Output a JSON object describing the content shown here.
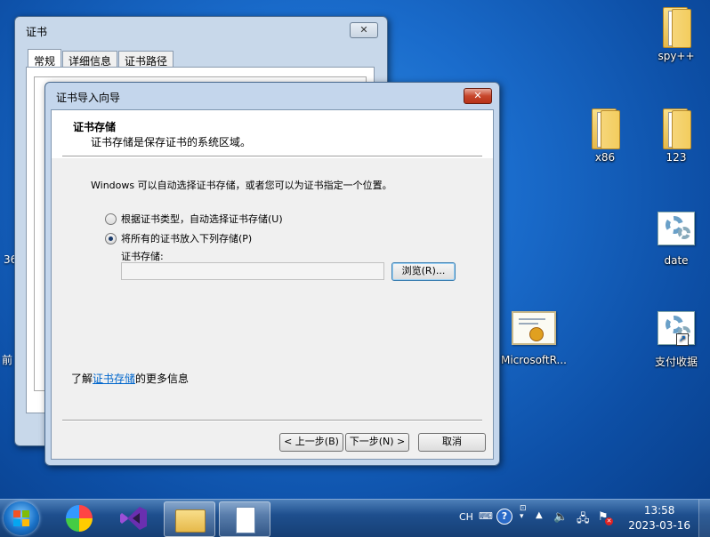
{
  "desktop": {
    "icons": [
      {
        "label": "spy++"
      },
      {
        "label": "x86"
      },
      {
        "label": "123"
      },
      {
        "label": "date"
      },
      {
        "label": "MicrosoftR..."
      },
      {
        "label": "支付收据"
      }
    ],
    "left_edge_fragments": [
      "36",
      "前"
    ]
  },
  "cert_window": {
    "title": "证书",
    "close_symbol": "✕",
    "tabs": [
      {
        "label": "常规"
      },
      {
        "label": "详细信息"
      },
      {
        "label": "证书路径"
      }
    ]
  },
  "wizard": {
    "title": "证书导入向导",
    "close_symbol": "✕",
    "header_title": "证书存储",
    "header_subtitle": "证书存储是保存证书的系统区域。",
    "intro_text": "Windows 可以自动选择证书存储，或者您可以为证书指定一个位置。",
    "options": [
      {
        "label": "根据证书类型，自动选择证书存储(U)",
        "selected": false
      },
      {
        "label": "将所有的证书放入下列存储(P)",
        "selected": true
      }
    ],
    "store_label": "证书存储:",
    "store_value": "",
    "browse_label": "浏览(R)...",
    "learn_prefix": "了解",
    "learn_link": "证书存储",
    "learn_suffix": "的更多信息",
    "back_label": "< 上一步(B)",
    "next_label": "下一步(N) >",
    "cancel_label": "取消"
  },
  "taskbar": {
    "language": "CH",
    "time": "13:58",
    "date": "2023-03-16"
  }
}
